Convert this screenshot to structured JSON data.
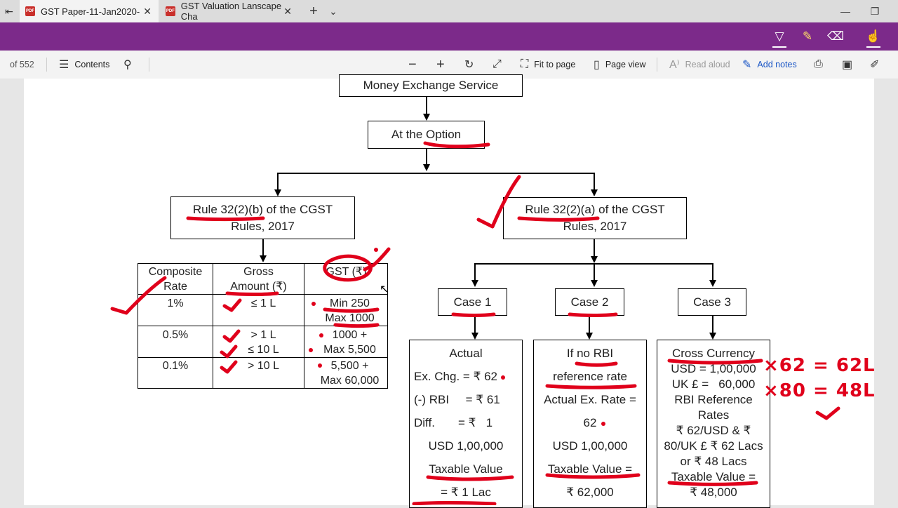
{
  "browser": {
    "tabs": [
      {
        "title": "GST Paper-11-Jan2020-",
        "active": true
      },
      {
        "title": "GST Valuation Lanscape Cha",
        "active": false
      }
    ]
  },
  "toolbar": {
    "page_count": "of 552",
    "contents": "Contents",
    "fit_to_page": "Fit to page",
    "page_view": "Page view",
    "read_aloud": "Read aloud",
    "add_notes": "Add notes"
  },
  "flow": {
    "top": "Money Exchange Service",
    "option": "At the Option",
    "rule_b": [
      "Rule 32(2)(b) of the CGST",
      "Rules, 2017"
    ],
    "rule_a": [
      "Rule 32(2)(a) of the CGST",
      "Rules, 2017"
    ],
    "cases": [
      "Case 1",
      "Case 2",
      "Case 3"
    ]
  },
  "rate_table": {
    "headers": [
      [
        "Composite",
        "Rate"
      ],
      [
        "Gross",
        "Amount (₹)"
      ],
      [
        "GST (₹)"
      ]
    ],
    "rows": [
      {
        "rate": "1%",
        "amount": [
          "≤ 1 L"
        ],
        "gst": [
          "Min 250",
          "Max 1000"
        ]
      },
      {
        "rate": "0.5%",
        "amount": [
          "> 1 L",
          "≤ 10 L"
        ],
        "gst": [
          "1000 +",
          "Max 5,500"
        ]
      },
      {
        "rate": "0.1%",
        "amount": [
          "> 10 L"
        ],
        "gst": [
          "5,500 +",
          "Max 60,000"
        ]
      }
    ]
  },
  "case1": [
    "Actual",
    "Ex. Chg. = ₹ 62",
    "(-) RBI     = ₹ 61",
    "Diff.       = ₹   1",
    "USD 1,00,000",
    "Taxable Value",
    "= ₹ 1 Lac"
  ],
  "case2": [
    "If no RBI",
    "reference rate",
    "Actual Ex. Rate =",
    "62",
    "USD 1,00,000",
    "Taxable Value =",
    "₹ 62,000"
  ],
  "case3": [
    "Cross Currency",
    "USD = 1,00,000",
    "UK £ =   60,000",
    "RBI Reference",
    "Rates",
    "₹ 62/USD & ₹",
    "80/UK £ ₹ 62 Lacs",
    "or ₹ 48 Lacs",
    "Taxable Value =",
    "₹ 48,000"
  ],
  "handwriting": [
    "×62 = 62L",
    "×80 = 48L"
  ],
  "colors": {
    "brand_purple": "#7c2a8a",
    "ink_red": "#e0001b",
    "accent_blue": "#1a56c6"
  }
}
